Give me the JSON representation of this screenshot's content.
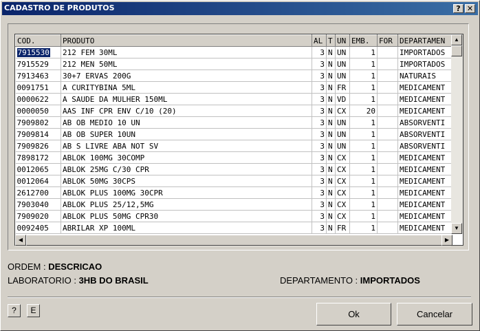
{
  "window": {
    "title": "CADASTRO DE PRODUTOS",
    "help_button": "?",
    "close_button": "✕"
  },
  "grid": {
    "columns": [
      "COD.",
      "PRODUTO",
      "AL",
      "T",
      "UN",
      "EMB.",
      "FOR",
      "DEPARTAMEN"
    ],
    "rows": [
      [
        "7915530",
        "212 FEM 30ML",
        "3",
        "N",
        "UN",
        "1",
        "",
        "IMPORTADOS"
      ],
      [
        "7915529",
        "212 MEN 50ML",
        "3",
        "N",
        "UN",
        "1",
        "",
        "IMPORTADOS"
      ],
      [
        "7913463",
        "30+7 ERVAS 200G",
        "3",
        "N",
        "UN",
        "1",
        "",
        "NATURAIS"
      ],
      [
        "0091751",
        "A CURITYBINA 5ML",
        "3",
        "N",
        "FR",
        "1",
        "",
        "MEDICAMENT"
      ],
      [
        "0000622",
        "A SAUDE DA MULHER 150ML",
        "3",
        "N",
        "VD",
        "1",
        "",
        "MEDICAMENT"
      ],
      [
        "0000050",
        "AAS INF CPR ENV C/10 (20)",
        "3",
        "N",
        "CX",
        "20",
        "",
        "MEDICAMENT"
      ],
      [
        "7909802",
        "AB OB MEDIO 10 UN",
        "3",
        "N",
        "UN",
        "1",
        "",
        "ABSORVENTI"
      ],
      [
        "7909814",
        "AB OB SUPER 10UN",
        "3",
        "N",
        "UN",
        "1",
        "",
        "ABSORVENTI"
      ],
      [
        "7909826",
        "AB S LIVRE ABA NOT SV",
        "3",
        "N",
        "UN",
        "1",
        "",
        "ABSORVENTI"
      ],
      [
        "7898172",
        "ABLOK 100MG 30COMP",
        "3",
        "N",
        "CX",
        "1",
        "",
        "MEDICAMENT"
      ],
      [
        "0012065",
        "ABLOK 25MG C/30 CPR",
        "3",
        "N",
        "CX",
        "1",
        "",
        "MEDICAMENT"
      ],
      [
        "0012064",
        "ABLOK 50MG 30CPS",
        "3",
        "N",
        "CX",
        "1",
        "",
        "MEDICAMENT"
      ],
      [
        "2612700",
        "ABLOK PLUS 100MG 30CPR",
        "3",
        "N",
        "CX",
        "1",
        "",
        "MEDICAMENT"
      ],
      [
        "7903040",
        "ABLOK PLUS 25/12,5MG",
        "3",
        "N",
        "CX",
        "1",
        "",
        "MEDICAMENT"
      ],
      [
        "7909020",
        "ABLOK PLUS 50MG CPR30",
        "3",
        "N",
        "CX",
        "1",
        "",
        "MEDICAMENT"
      ],
      [
        "0092405",
        "ABRILAR XP 100ML",
        "3",
        "N",
        "FR",
        "1",
        "",
        "MEDICAMENT"
      ]
    ]
  },
  "info": {
    "ordem_label": "ORDEM :",
    "ordem_value": "DESCRICAO",
    "laboratorio_label": "LABORATORIO :",
    "laboratorio_value": "3HB DO BRASIL",
    "departamento_label": "DEPARTAMENTO :",
    "departamento_value": "IMPORTADOS"
  },
  "buttons": {
    "help": "?",
    "e": "E",
    "ok": "Ok",
    "cancel": "Cancelar"
  },
  "colors": {
    "titlebar_start": "#0a246a",
    "titlebar_end": "#3a6ea5",
    "selection": "#0a246a",
    "face": "#d4d0c8"
  }
}
